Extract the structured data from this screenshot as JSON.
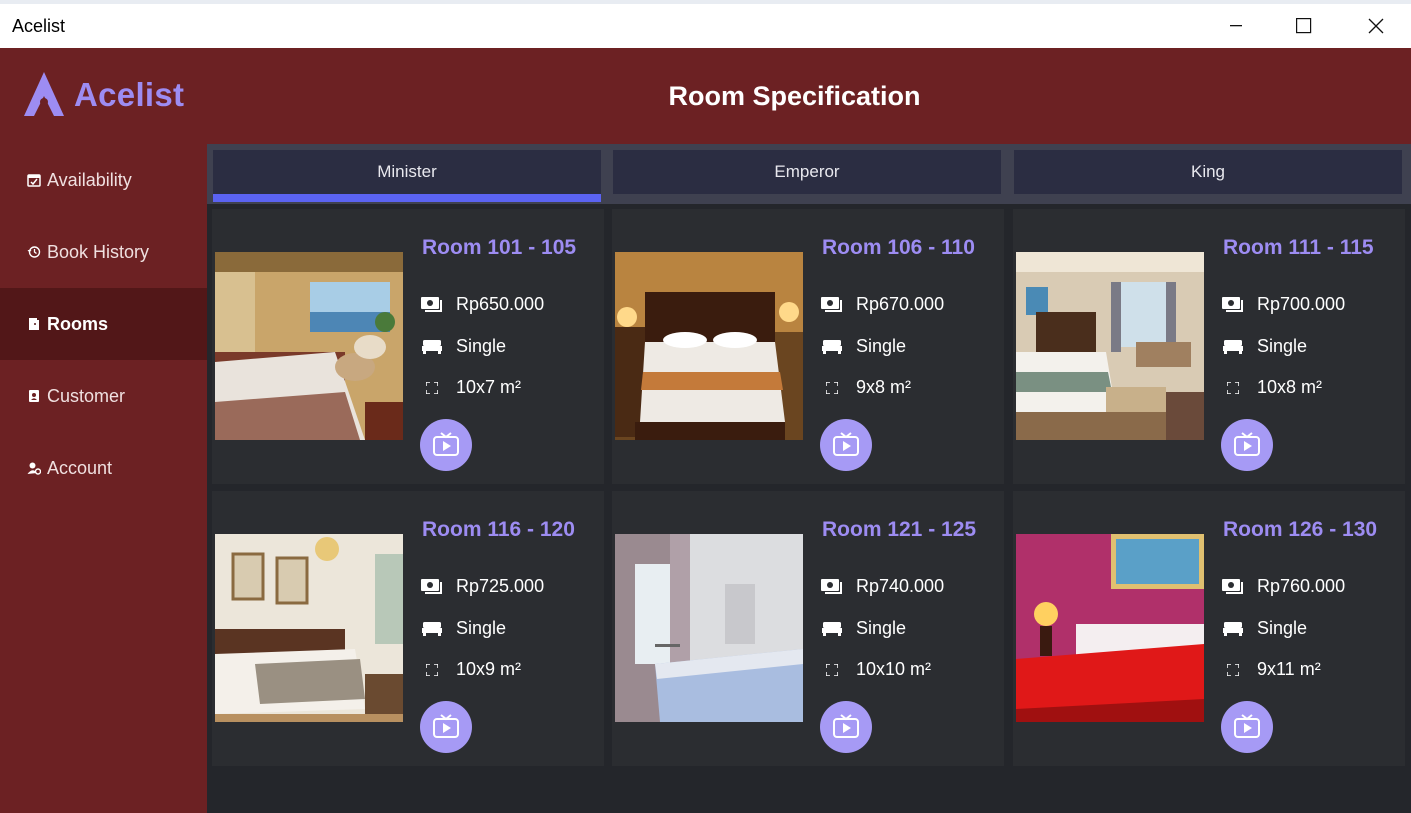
{
  "window": {
    "title": "Acelist"
  },
  "brand": {
    "name": "Acelist"
  },
  "header": {
    "title": "Room Specification"
  },
  "sidebar": {
    "items": [
      {
        "label": "Availability",
        "icon": "calendar-check-icon",
        "active": false
      },
      {
        "label": "Book History",
        "icon": "history-icon",
        "active": false
      },
      {
        "label": "Rooms",
        "icon": "door-icon",
        "active": true
      },
      {
        "label": "Customer",
        "icon": "id-badge-icon",
        "active": false
      },
      {
        "label": "Account",
        "icon": "user-gear-icon",
        "active": false
      }
    ]
  },
  "tabs": [
    {
      "label": "Minister",
      "active": true
    },
    {
      "label": "Emperor",
      "active": false
    },
    {
      "label": "King",
      "active": false
    }
  ],
  "rooms": [
    {
      "name": "Room 101 - 105",
      "price": "Rp650.000",
      "bed": "Single",
      "size": "10x7 m²"
    },
    {
      "name": "Room 106 - 110",
      "price": "Rp670.000",
      "bed": "Single",
      "size": "9x8 m²"
    },
    {
      "name": "Room 111 - 115",
      "price": "Rp700.000",
      "bed": "Single",
      "size": "10x8 m²"
    },
    {
      "name": "Room 116 - 120",
      "price": "Rp725.000",
      "bed": "Single",
      "size": "10x9 m²"
    },
    {
      "name": "Room 121 - 125",
      "price": "Rp740.000",
      "bed": "Single",
      "size": "10x10 m²"
    },
    {
      "name": "Room 126 - 130",
      "price": "Rp760.000",
      "bed": "Single",
      "size": "9x11 m²"
    }
  ],
  "colors": {
    "sidebar": "#6c2123",
    "sidebar_active": "#521718",
    "accent": "#9d8cf2",
    "tab_indicator": "#5b63f2",
    "card": "#2b2d31",
    "content_bg": "#24262b"
  }
}
